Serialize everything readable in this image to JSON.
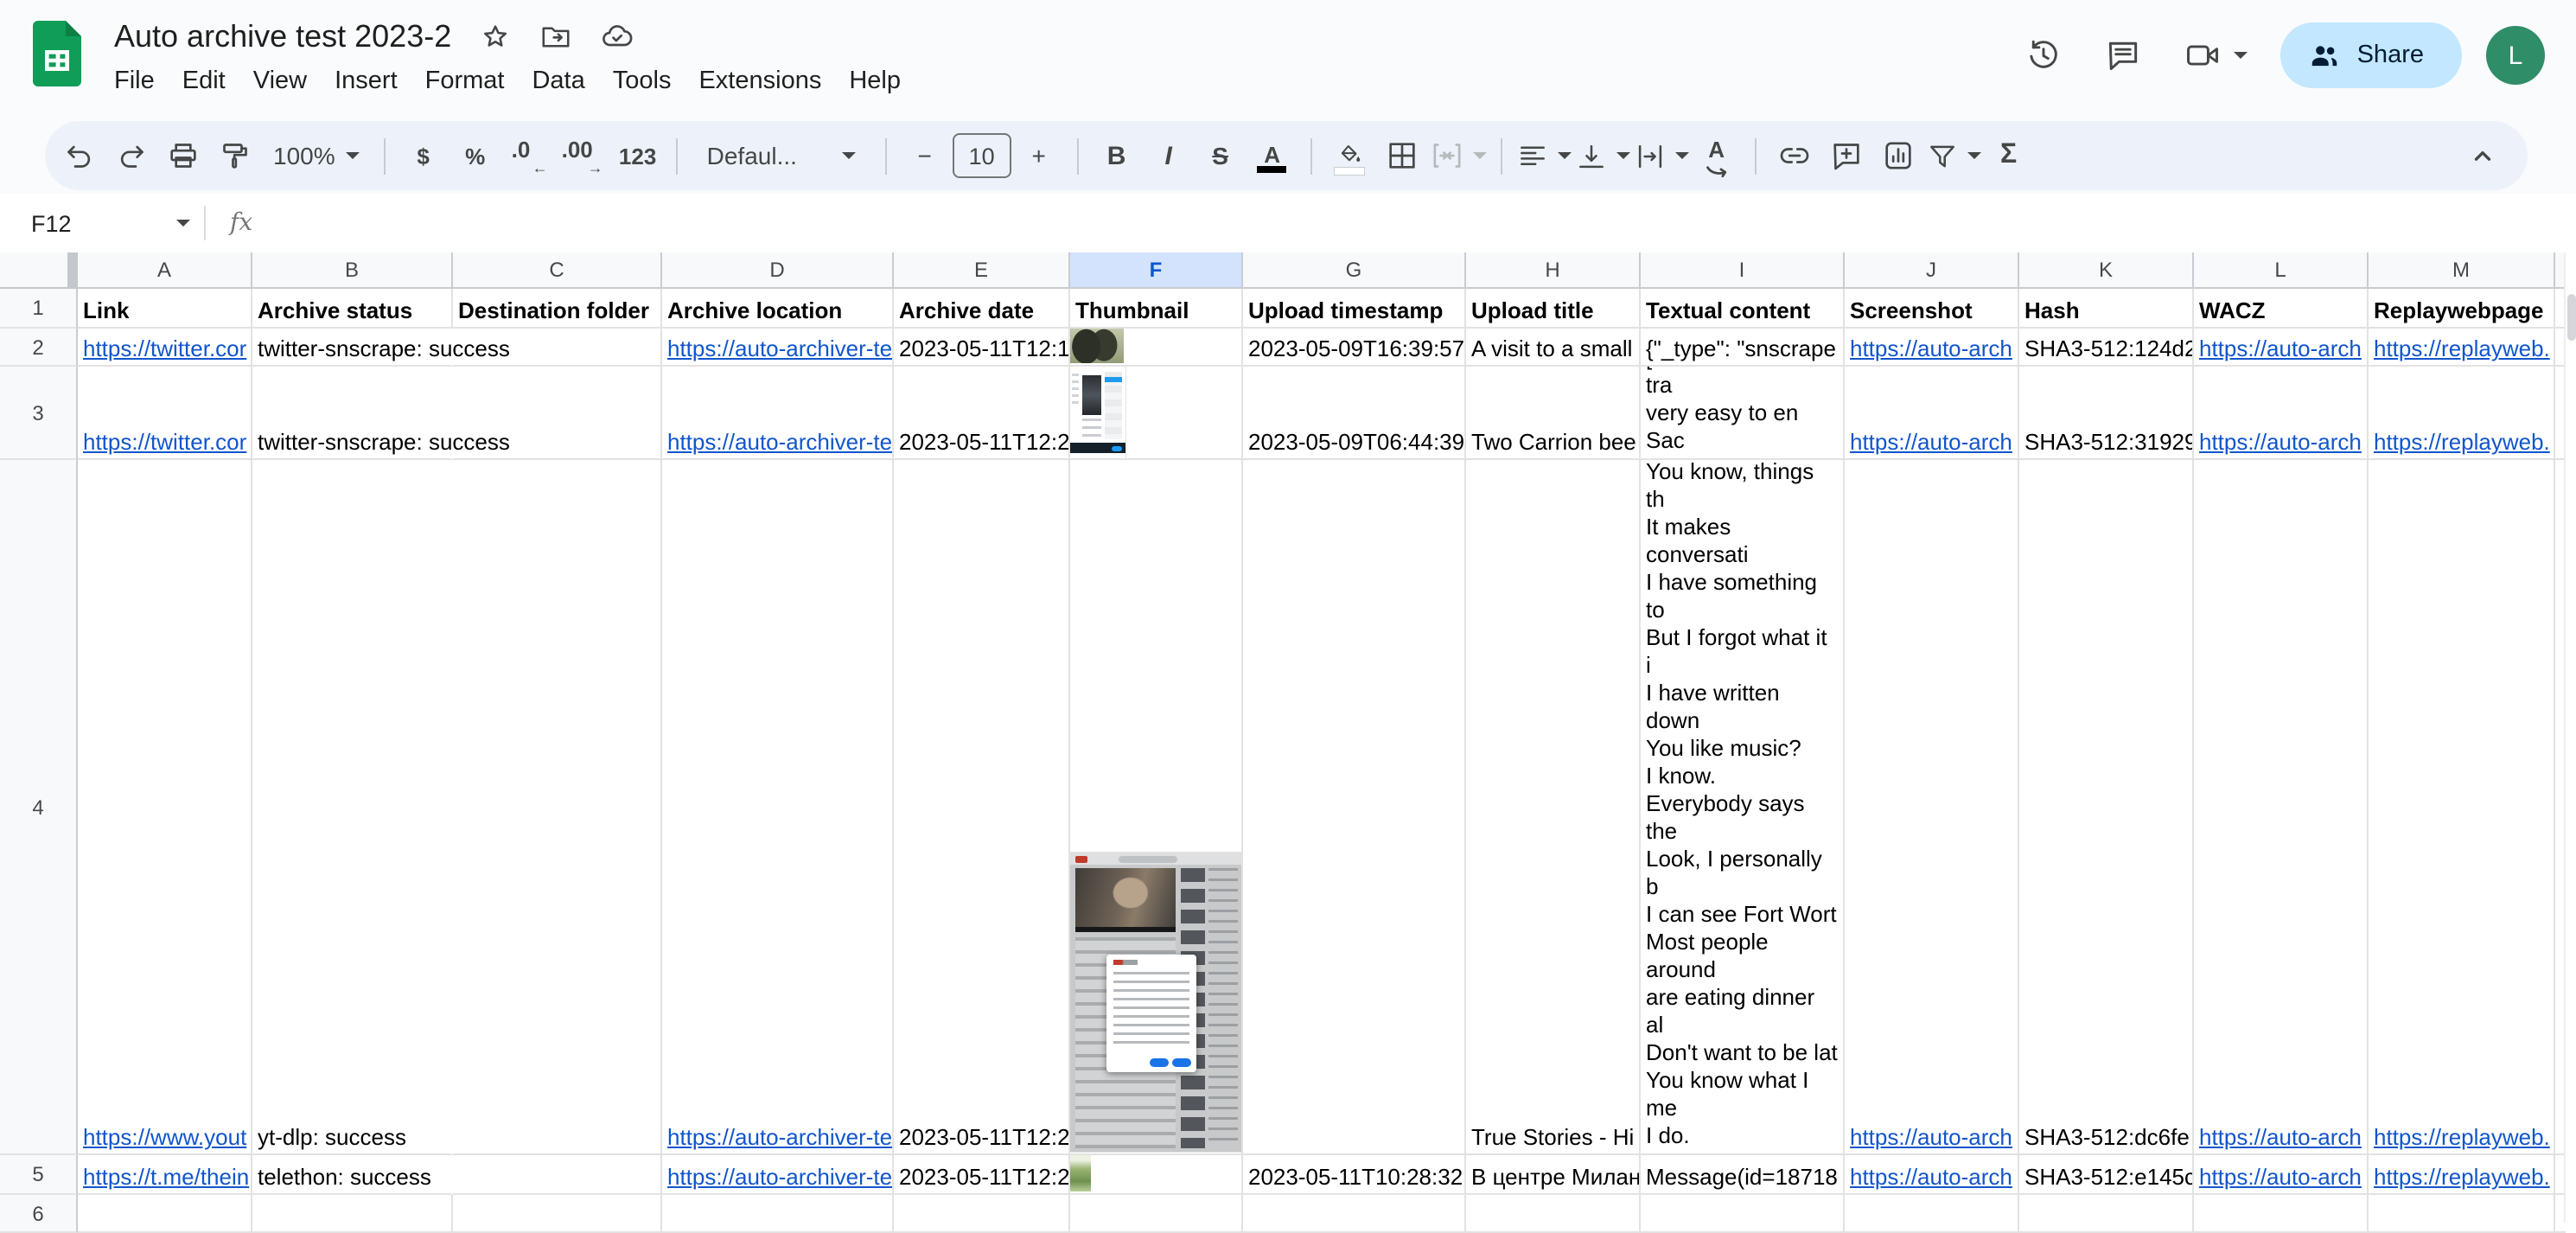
{
  "titlebar": {
    "title": "Auto archive test 2023-2",
    "menu": [
      "File",
      "Edit",
      "View",
      "Insert",
      "Format",
      "Data",
      "Tools",
      "Extensions",
      "Help"
    ],
    "share": "Share",
    "avatar": "L"
  },
  "toolbar": {
    "zoom": "100%",
    "currency": "$",
    "percent": "%",
    "decimal_decrease": ".0",
    "decimal_decrease_arrow": "←",
    "decimal_increase": ".00",
    "decimal_increase_arrow": "→",
    "number_format": "123",
    "font": "Defaul...",
    "font_size": "10",
    "minus": "−",
    "plus": "+",
    "bold": "B",
    "italic": "I",
    "strikethrough": "S",
    "text_color": "A",
    "rotate_letter": "A",
    "functions": "Σ"
  },
  "formula_bar": {
    "cell_ref": "F12",
    "fx": "fx"
  },
  "grid": {
    "columns": [
      "A",
      "B",
      "C",
      "D",
      "E",
      "F",
      "G",
      "H",
      "I",
      "J",
      "K",
      "L",
      "M"
    ],
    "selected_column": "F",
    "rows": [
      "1",
      "2",
      "3",
      "4",
      "5",
      "6"
    ]
  },
  "cells": {
    "A1": "Link",
    "B1": "Archive status",
    "C1": "Destination folder",
    "D1": "Archive location",
    "E1": "Archive date",
    "F1": "Thumbnail",
    "G1": "Upload timestamp",
    "H1": "Upload title",
    "I1": "Textual content",
    "J1": "Screenshot",
    "K1": "Hash",
    "L1": "WACZ",
    "M1": "Replaywebpage",
    "A2": "https://twitter.cor",
    "B2": "twitter-snscrape: success",
    "D2": "https://auto-archiver-te",
    "E2": "2023-05-11T12:1",
    "G2": "2023-05-09T16:39:57",
    "H2": "A visit to a small",
    "I2": "{\"_type\": \"snscrape",
    "J2": "https://auto-arch",
    "K2": "SHA3-512:124d2",
    "L2": "https://auto-arch",
    "M2": "https://replayweb.",
    "A3": "https://twitter.cor",
    "B3": "twitter-snscrape: success",
    "D3": "https://auto-archiver-te",
    "E3": "2023-05-11T12:2",
    "G3": "2023-05-09T06:44:39",
    "H3": "Two Carrion bee",
    "I3": "{\"_type\": \"snscrape\n[automatic video tra\nvery easy to en Sac",
    "J3": "https://auto-arch",
    "K3": "SHA3-512:31929",
    "L3": "https://auto-arch",
    "M3": "https://replayweb.",
    "A4": "https://www.yout",
    "B4": "yt-dlp: success",
    "D4": "https://auto-archiver-te",
    "E4": "2023-05-11T12:2",
    "H4": "True Stories - Hi",
    "I4": "[automatic video tra\nThey're the cathedr\nNot me.\nYou know, around h\nThe slingshotter.\nThe adventurer.\nThe marshmallow.\nThe Nomad.\nAnd the Weaver.\nYep. It's fancy drivin\nYou know, things th\nIt makes conversati\nI have something to\nBut I forgot what it i\nI have written down\nYou like music?\nI know.\nEverybody says the\nLook, I personally b\nI can see Fort Wort\nMost people around\nare eating dinner al\nDon't want to be lat\nYou know what I me\nI do.",
    "J4": "https://auto-arch",
    "K4": "SHA3-512:dc6fe",
    "L4": "https://auto-arch",
    "M4": "https://replayweb.",
    "A5": "https://t.me/thein",
    "B5": "telethon: success",
    "D5": "https://auto-archiver-te",
    "E5": "2023-05-11T12:2",
    "G5": "2023-05-11T10:28:32",
    "H5": "В центре Милан",
    "I5": "Message(id=18718",
    "J5": "https://auto-arch",
    "K5": "SHA3-512:e145c",
    "L5": "https://auto-arch",
    "M5": "https://replayweb."
  },
  "thumbnails": {
    "row2": "seed-pods-photo",
    "row3": "twitter-post-page-screenshot",
    "row4": "youtube-page-screenshot-with-consent-dialog",
    "row5": "green-photo"
  },
  "colors": {
    "link": "#1155cc",
    "share_bg": "#c2e7ff",
    "share_text": "#001d35",
    "avatar_bg": "#2f8d68",
    "selected_header_bg": "#d3e3fd",
    "selected_header_text": "#0b57d0",
    "logo_green": "#0f9d58",
    "toolbar_pill": "#edf2fa"
  }
}
